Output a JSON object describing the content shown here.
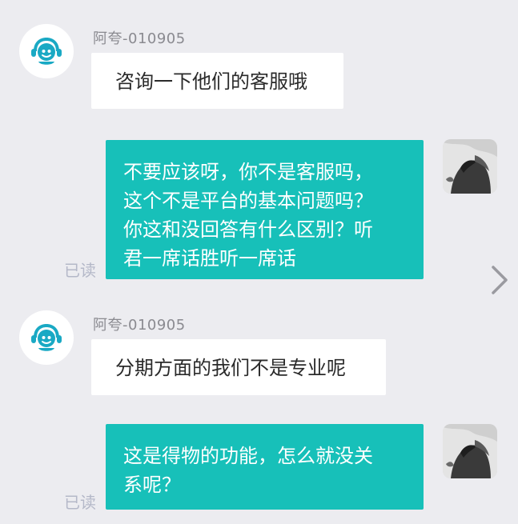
{
  "colors": {
    "background": "#ececf0",
    "agent_bubble": "#ffffff",
    "user_bubble": "#17c0b9",
    "read_text": "#b4b8c8",
    "avatar_accent": "#1aa9c4"
  },
  "messages": [
    {
      "side": "left",
      "sender": "阿夸-010905",
      "text": "咨询一下他们的客服哦",
      "avatar_icon": "customer-service-avatar-icon"
    },
    {
      "side": "right",
      "text": "不要应该呀，你不是客服吗，\n这个不是平台的基本问题吗？\n你这和没回答有什么区别？听\n君一席话胜听一席话",
      "read_status": "已读",
      "avatar_icon": "user-avatar-icon"
    },
    {
      "side": "left",
      "sender": "阿夸-010905",
      "text": "分期方面的我们不是专业呢",
      "avatar_icon": "customer-service-avatar-icon"
    },
    {
      "side": "right",
      "text": "这是得物的功能，怎么就没关\n系呢？",
      "read_status": "已读",
      "avatar_icon": "user-avatar-icon"
    }
  ],
  "navigation": {
    "next_icon": "chevron-right-icon"
  }
}
